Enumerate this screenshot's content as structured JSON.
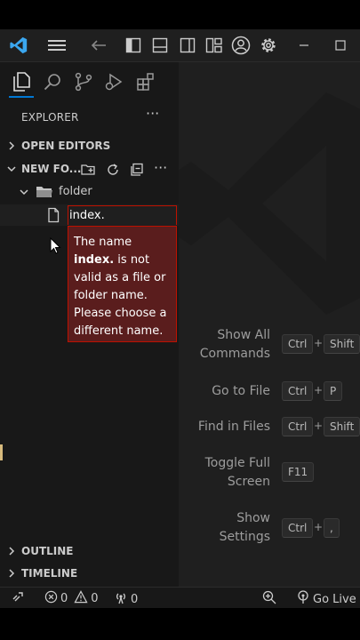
{
  "sidebar": {
    "header": "EXPLORER",
    "more": "···",
    "sections": {
      "open_editors": "OPEN EDITORS",
      "workspace": "NEW FO...",
      "outline": "OUTLINE",
      "timeline": "TIMELINE"
    },
    "tree": {
      "folder": "folder",
      "input_value": "index."
    }
  },
  "error": {
    "prefix": "The name ",
    "name": "index.",
    "suffix": " is not valid as a file or folder name. Please choose a different name."
  },
  "commands": [
    {
      "label": "Show All Commands",
      "keys": [
        "Ctrl",
        "Shift"
      ]
    },
    {
      "label": "Go to File",
      "keys": [
        "Ctrl",
        "P"
      ]
    },
    {
      "label": "Find in Files",
      "keys": [
        "Ctrl",
        "Shift"
      ]
    },
    {
      "label": "Toggle Full Screen",
      "keys": [
        "F11"
      ]
    },
    {
      "label": "Show Settings",
      "keys": [
        "Ctrl",
        ","
      ]
    }
  ],
  "plus_sign": "+",
  "status": {
    "errors": "0",
    "warnings": "0",
    "ports": "0",
    "go_live": "Go Live"
  },
  "colors": {
    "accent": "#0078d4",
    "error_bg": "#5a1d1d",
    "error_border": "#be1100"
  }
}
